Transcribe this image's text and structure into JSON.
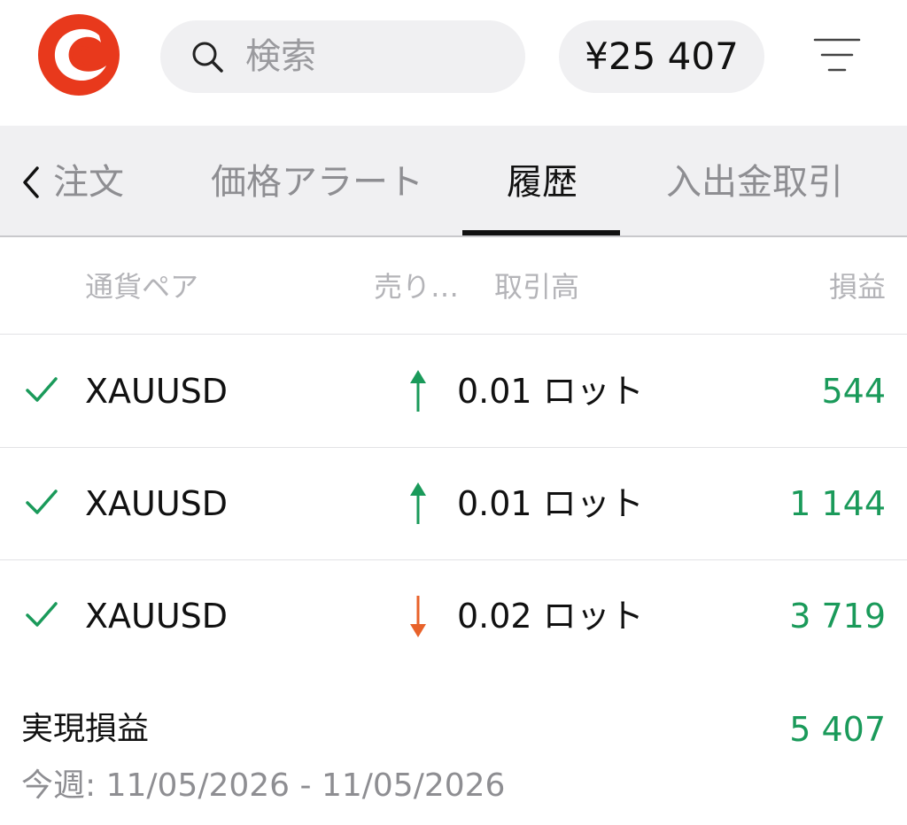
{
  "header": {
    "search_placeholder": "検索",
    "balance": "¥25 407",
    "brand_color": "#e8391c"
  },
  "tabs": {
    "items": [
      {
        "label": "注文"
      },
      {
        "label": "価格アラート"
      },
      {
        "label": "履歴",
        "active": true
      },
      {
        "label": "入出金取引"
      }
    ]
  },
  "columns": {
    "pair": "通貨ペア",
    "side": "売り…",
    "volume": "取引高",
    "pnl": "損益"
  },
  "rows": [
    {
      "symbol": "XAUUSD",
      "direction": "up-arrow-icon",
      "volume": "0.01 ロット",
      "pnl": "544"
    },
    {
      "symbol": "XAUUSD",
      "direction": "up-arrow-icon",
      "volume": "0.01 ロット",
      "pnl": "1 144"
    },
    {
      "symbol": "XAUUSD",
      "direction": "down-arrow-icon",
      "volume": "0.02 ロット",
      "pnl": "3 719"
    }
  ],
  "summary": {
    "label": "実現損益",
    "value": "5 407",
    "period": "今週: 11/05/2026 - 11/05/2026"
  },
  "colors": {
    "profit": "#1a9a5a",
    "buy_arrow": "#1a9a5a",
    "sell_arrow": "#e8622a"
  }
}
